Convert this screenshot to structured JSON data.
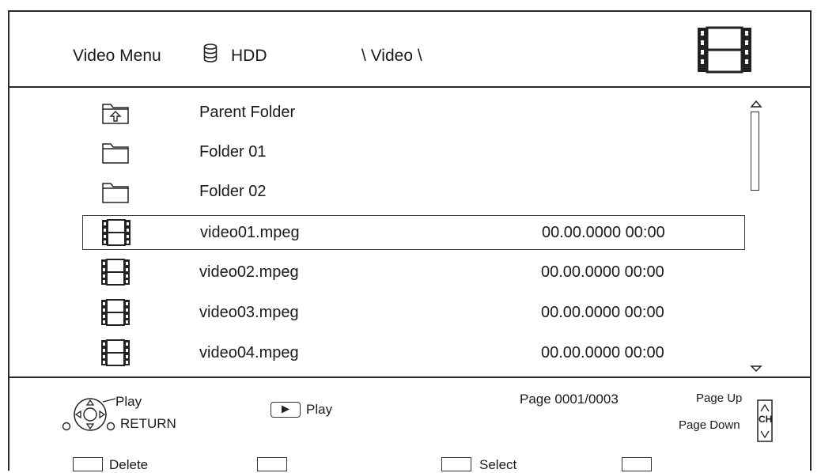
{
  "header": {
    "title": "Video Menu",
    "drive_icon": "hdd-stack-icon",
    "drive_label": "HDD",
    "path": "\\ Video \\",
    "mode_icon": "film-strip-icon"
  },
  "list": {
    "items": [
      {
        "icon": "parent-folder-icon",
        "name": "Parent Folder",
        "date": ""
      },
      {
        "icon": "folder-icon",
        "name": "Folder 01",
        "date": ""
      },
      {
        "icon": "folder-icon",
        "name": "Folder 02",
        "date": ""
      },
      {
        "icon": "film-strip-icon",
        "name": "video01.mpeg",
        "date": "00.00.0000 00:00",
        "selected": true
      },
      {
        "icon": "film-strip-icon",
        "name": "video02.mpeg",
        "date": "00.00.0000 00:00"
      },
      {
        "icon": "film-strip-icon",
        "name": "video03.mpeg",
        "date": "00.00.0000 00:00"
      },
      {
        "icon": "film-strip-icon",
        "name": "video04.mpeg",
        "date": "00.00.0000 00:00"
      }
    ]
  },
  "footer": {
    "dpad_play_label": "Play",
    "return_label": "RETURN",
    "play_button_label": "Play",
    "page_label": "Page 0001/0003",
    "page_up_label": "Page Up",
    "page_down_label": "Page Down",
    "ch_label": "CH",
    "delete_label": "Delete",
    "select_label": "Select"
  }
}
